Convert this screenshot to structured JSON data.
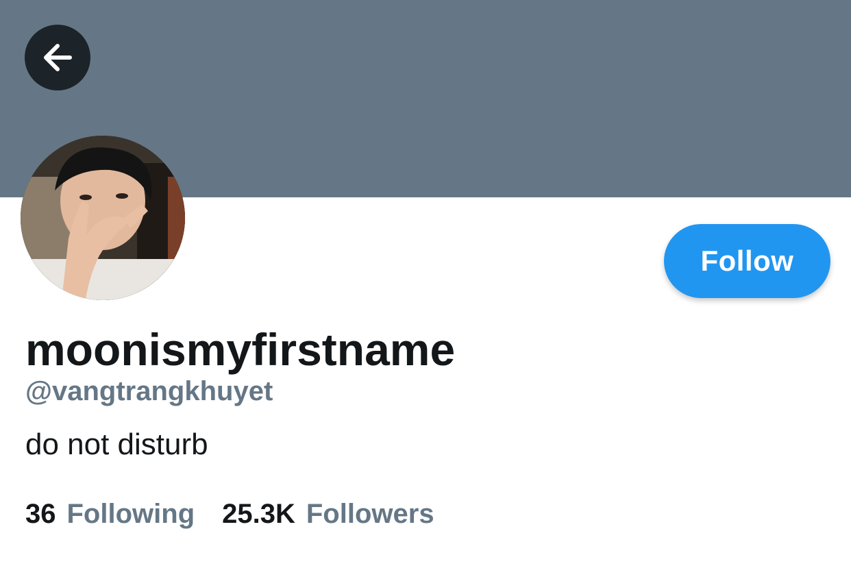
{
  "header": {
    "back_icon": "arrow-left-icon",
    "banner_color": "#657786"
  },
  "profile": {
    "display_name": "moonismyfirstname",
    "handle": "@vangtrangkhuyet",
    "bio": "do not disturb",
    "avatar": "profile-photo"
  },
  "actions": {
    "follow_label": "Follow",
    "follow_color": "#2196f0"
  },
  "stats": {
    "following_count": "36",
    "following_label": "Following",
    "followers_count": "25.3K",
    "followers_label": "Followers"
  }
}
